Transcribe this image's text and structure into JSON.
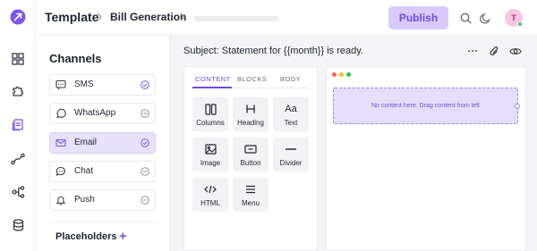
{
  "header": {
    "breadcrumb_root": "Template",
    "breadcrumb_current": "Bill Generation",
    "publish_label": "Publish",
    "avatar_initial": "T"
  },
  "rail": {
    "icons": [
      "logo-icon",
      "grid-icon",
      "puzzle-icon",
      "templates-icon",
      "workflow-icon",
      "hierarchy-icon",
      "database-icon"
    ]
  },
  "channels": {
    "title": "Channels",
    "items": [
      {
        "label": "SMS",
        "icon": "sms-icon",
        "status": "check"
      },
      {
        "label": "WhatsApp",
        "icon": "whatsapp-icon",
        "status": "minus"
      },
      {
        "label": "Email",
        "icon": "email-icon",
        "status": "check",
        "active": true
      },
      {
        "label": "Chat",
        "icon": "chat-icon",
        "status": "minus"
      },
      {
        "label": "Push",
        "icon": "bell-icon",
        "status": "minus"
      }
    ],
    "placeholders_label": "Placeholders",
    "placeholders_add": "+"
  },
  "editor": {
    "subject": "Subject: Statement for {{month}} is ready."
  },
  "blocks_panel": {
    "tabs": [
      "CONTENT",
      "BLOCKS",
      "BODY"
    ],
    "active_tab": "CONTENT",
    "tiles": [
      "Columns",
      "Heading",
      "Text",
      "Image",
      "Button",
      "Divider",
      "HTML",
      "Menu"
    ]
  },
  "canvas": {
    "empty_text": "No content here. Drag content from left"
  },
  "colors": {
    "accent": "#6f49e8",
    "publish_bg": "#d8cbfb",
    "active_channel_bg": "#e7e1fb",
    "dropzone_bg": "#e5defa"
  }
}
